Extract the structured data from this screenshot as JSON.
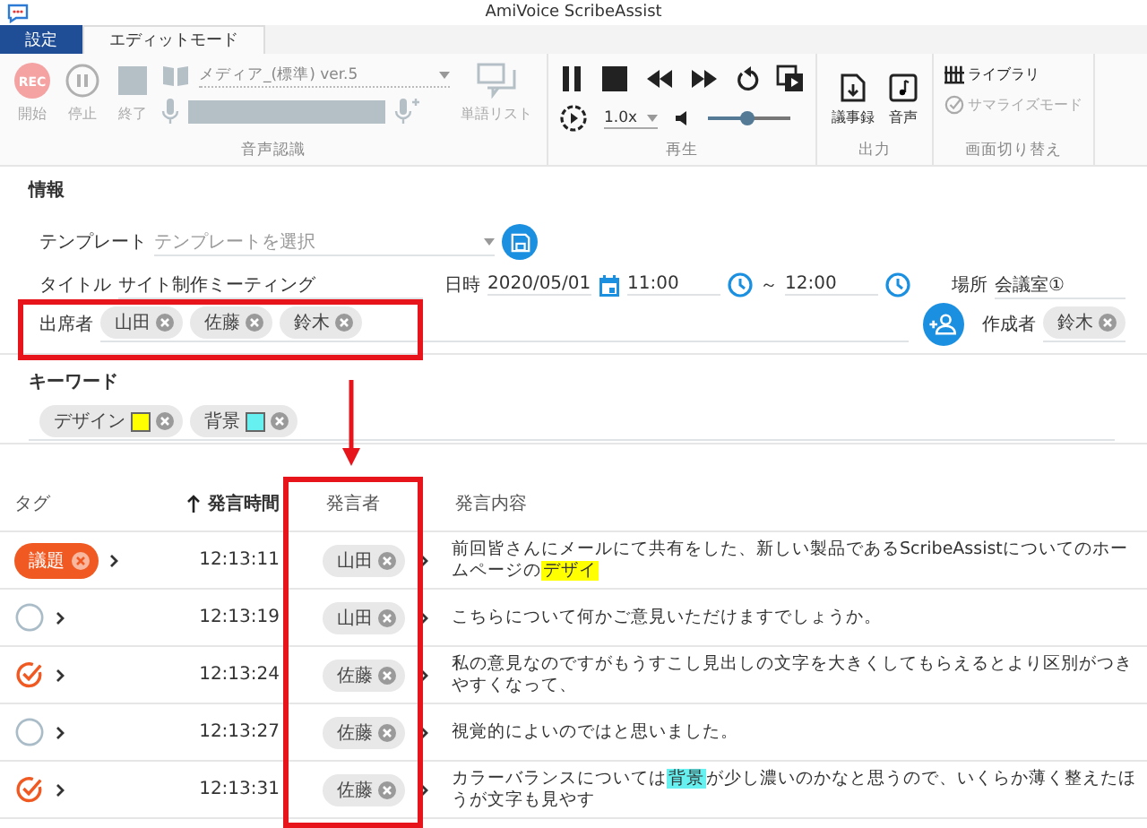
{
  "window": {
    "title": "AmiVoice ScribeAssist"
  },
  "tabs": [
    {
      "label": "設定",
      "kind": "menu",
      "selected": false
    },
    {
      "label": "エディットモード",
      "kind": "tab",
      "selected": true
    }
  ],
  "ribbon": {
    "recognition": {
      "label": "音声認識",
      "buttons": [
        {
          "label": "開始",
          "kind": "rec",
          "icon_text": "REC",
          "disabled": true
        },
        {
          "label": "停止",
          "kind": "pause",
          "disabled": true
        },
        {
          "label": "終了",
          "kind": "stop",
          "disabled": true
        }
      ],
      "engine": {
        "value": "メディア_(標準) ver.5",
        "disabled": true
      },
      "word_list": {
        "label": "単語リスト",
        "disabled": true
      }
    },
    "playback": {
      "label": "再生",
      "speed": "1.0x",
      "volume": {
        "level": 0.48
      }
    },
    "output": {
      "label": "出力",
      "buttons": [
        {
          "label": "議事録",
          "kind": "document"
        },
        {
          "label": "音声",
          "kind": "music"
        }
      ]
    },
    "view": {
      "label": "画面切り替え",
      "buttons": [
        {
          "label": "ライブラリ",
          "kind": "library",
          "disabled": false
        },
        {
          "label": "サマライズモード",
          "kind": "summary",
          "disabled": true
        }
      ]
    }
  },
  "info": {
    "heading": "情報",
    "template": {
      "label": "テンプレート",
      "placeholder": "テンプレートを選択"
    },
    "title": {
      "label": "タイトル",
      "value": "サイト制作ミーティング"
    },
    "datetime": {
      "label": "日時",
      "date": "2020/05/01",
      "start": "11:00",
      "separator": "～",
      "end": "12:00"
    },
    "place": {
      "label": "場所",
      "value": "会議室①"
    },
    "attendees": {
      "label": "出席者",
      "names": [
        "山田",
        "佐藤",
        "鈴木"
      ]
    },
    "author": {
      "label": "作成者",
      "names": [
        "鈴木"
      ]
    }
  },
  "keywords": {
    "heading": "キーワード",
    "items": [
      {
        "label": "デザイン",
        "color": "#ffff00"
      },
      {
        "label": "背景",
        "color": "#66f0f0"
      }
    ]
  },
  "table": {
    "columns": [
      {
        "label": "タグ",
        "sorted": false
      },
      {
        "label": "発言時間",
        "sorted": true
      },
      {
        "label": "発言者",
        "sorted": false
      },
      {
        "label": "発言内容",
        "sorted": false
      }
    ],
    "rows": [
      {
        "tag": {
          "kind": "label",
          "label": "議題"
        },
        "time": "12:13:11",
        "speaker": "山田",
        "segments": [
          {
            "text": "前回皆さんにメールにて共有をした、新しい製品であるScribeAssistについてのホームページの"
          },
          {
            "text": "デザイ",
            "color": "#ffff00"
          }
        ]
      },
      {
        "tag": {
          "kind": "none"
        },
        "time": "12:13:19",
        "speaker": "山田",
        "segments": [
          {
            "text": "こちらについて何かご意見いただけますでしょうか。"
          }
        ]
      },
      {
        "tag": {
          "kind": "check"
        },
        "time": "12:13:24",
        "speaker": "佐藤",
        "segments": [
          {
            "text": "私の意見なのですがもうすこし見出しの文字を大きくしてもらえるとより区別がつきやすくなって、"
          }
        ]
      },
      {
        "tag": {
          "kind": "none"
        },
        "time": "12:13:27",
        "speaker": "佐藤",
        "segments": [
          {
            "text": "視覚的によいのではと思いました。"
          }
        ]
      },
      {
        "tag": {
          "kind": "check"
        },
        "time": "12:13:31",
        "speaker": "佐藤",
        "segments": [
          {
            "text": "カラーバランスについては"
          },
          {
            "text": "背景",
            "color": "#66f0f0"
          },
          {
            "text": "が少し濃いのかなと思うので、いくらか薄く整えたほうが文字も見やす"
          }
        ]
      }
    ]
  }
}
